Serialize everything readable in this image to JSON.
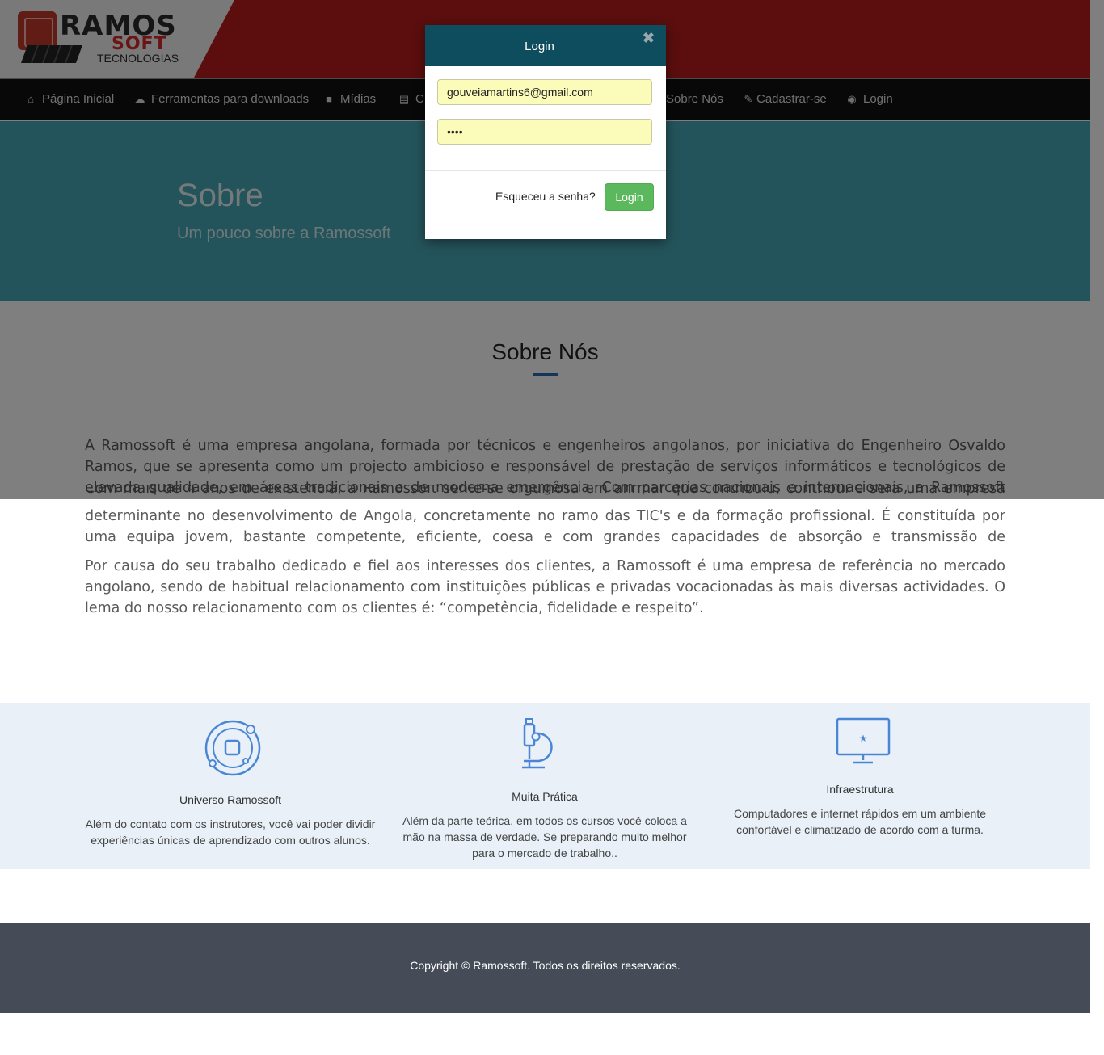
{
  "brand": {
    "name": "RAMOS",
    "sub": "SOFT",
    "tagline": "TECNOLOGIAS"
  },
  "nav": {
    "items": [
      {
        "label": "Página Inicial",
        "icon": "home-icon",
        "glyph": "⌂"
      },
      {
        "label": "Ferramentas para downloads",
        "icon": "cloud-download-icon",
        "glyph": "☁"
      },
      {
        "label": "Mídias",
        "icon": "video-camera-icon",
        "glyph": "■"
      },
      {
        "label": "C",
        "icon": "book-icon",
        "glyph": "▤"
      },
      {
        "label": "Sobre Nós",
        "icon": "",
        "glyph": ""
      },
      {
        "label": "Cadastrar-se",
        "icon": "edit-icon",
        "glyph": "✎"
      },
      {
        "label": "Login",
        "icon": "user-circle-icon",
        "glyph": "◉"
      }
    ]
  },
  "hero": {
    "title": "Sobre",
    "subtitle": "Um pouco sobre a Ramossoft"
  },
  "about": {
    "title": "Sobre Nós",
    "paragraph1_top": "A Ramossoft é uma empresa angolana, formada por técnicos e engenheiros angolanos, por iniciativa do Engenheiro Osvaldo Ramos, que se apresenta como um projecto ambicioso e responsável de prestação de serviços informáticos e tecnológicos de elevada qualidade, em áreas tradicionais e de moderna emergência. Com parcerias nacionais e internacionais, a Ramossoft actua no",
    "paragraph1_bottom": "Com mais de 4 anos de existência, a Ramossoft sente-se orgulhosa em afirmar que contribuiu, contribui e será uma empresa determinante no desenvolvimento de Angola, concretamente no ramo das TIC's e da formação profissional. É constituída por uma equipa jovem, bastante competente, eficiente, coesa e com grandes capacidades de absorção e transmissão de conhecimentos.",
    "paragraph2": "Por causa do seu trabalho dedicado e fiel aos interesses dos clientes, a Ramossoft é uma empresa de referência no mercado angolano, sendo de habitual relacionamento com instituições públicas e privadas vocacionadas às mais diversas actividades. O lema do nosso relacionamento com os clientes é: “competência, fidelidade e respeito”."
  },
  "features": [
    {
      "icon": "orbit-icon",
      "title": "Universo Ramossoft",
      "desc": "Além do contato com os instrutores, você vai poder dividir experiências únicas de aprendizado com outros alunos."
    },
    {
      "icon": "microscope-icon",
      "title": "Muita Prática",
      "desc": "Além da parte teórica, em todos os cursos você coloca a mão na massa de verdade. Se preparando muito melhor para o mercado de trabalho.."
    },
    {
      "icon": "monitor-icon",
      "title": "Infraestrutura",
      "desc": "Computadores e internet rápidos em um ambiente confortável e climatizado de acordo com a turma."
    }
  ],
  "footer": {
    "text": "Copyright © Ramossoft. Todos os direitos reservados."
  },
  "modal": {
    "title": "Login",
    "close_glyph": "✖",
    "email_value": "gouveiamartins6@gmail.com",
    "password_value": "1234",
    "forgot_label": "Esqueceu a senha?",
    "submit_label": "Login"
  },
  "colors": {
    "header_red": "#b81c1c",
    "navbar": "#111111",
    "hero": "#48a9b6",
    "accent_blue": "#2a6ab3",
    "features_bg": "#e9f0f7",
    "footer": "#454c57",
    "modal_header": "#0d4d5e",
    "button_green": "#5cb85c",
    "icon_blue": "#4a86d6"
  }
}
